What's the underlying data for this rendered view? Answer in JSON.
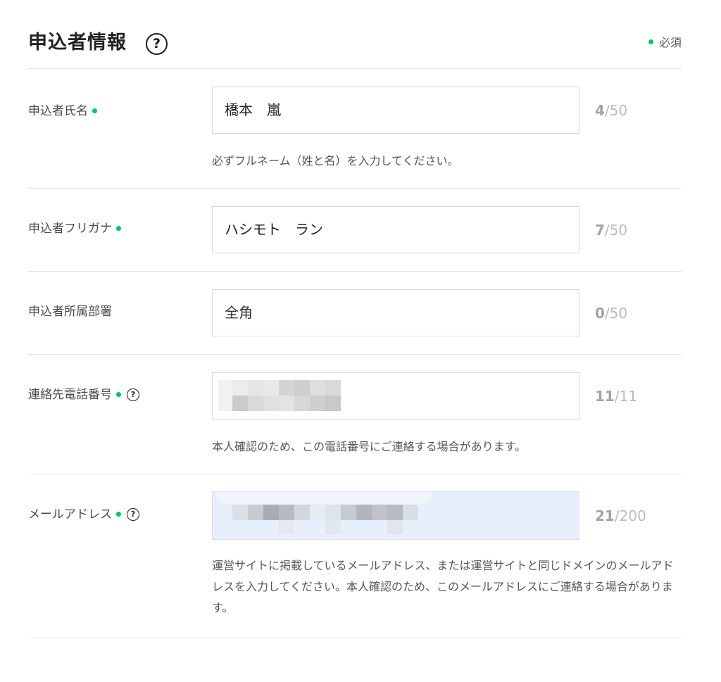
{
  "section": {
    "title": "申込者情報",
    "help_symbol": "?",
    "required_legend": "必須"
  },
  "colors": {
    "required_dot": "#06c755",
    "autofill_bg": "#e8effc",
    "counter": "#b7bcc2"
  },
  "fields": [
    {
      "label": "申込者氏名",
      "required": true,
      "has_help": false,
      "value": "橋本　嵐",
      "count": "4",
      "max": "/50",
      "hint": "必ずフルネーム（姓と名）を入力してください。"
    },
    {
      "label": "申込者フリガナ",
      "required": true,
      "has_help": false,
      "value": "ハシモト　ラン",
      "count": "7",
      "max": "/50",
      "hint": ""
    },
    {
      "label": "申込者所属部署",
      "required": false,
      "has_help": false,
      "value": "",
      "placeholder": "全角",
      "count": "0",
      "max": "/50",
      "hint": ""
    },
    {
      "label": "連絡先電話番号",
      "required": true,
      "has_help": true,
      "value_redacted": true,
      "count": "11",
      "max": "/11",
      "hint": "本人確認のため、この電話番号にご連絡する場合があります。"
    },
    {
      "label": "メールアドレス",
      "required": true,
      "has_help": true,
      "value_redacted": true,
      "count": "21",
      "max": "/200",
      "hint": "運営サイトに掲載しているメールアドレス、または運営サイトと同じドメインのメールアドレスを入力してください。本人確認のため、このメールアドレスにご連絡する場合があります。"
    }
  ]
}
